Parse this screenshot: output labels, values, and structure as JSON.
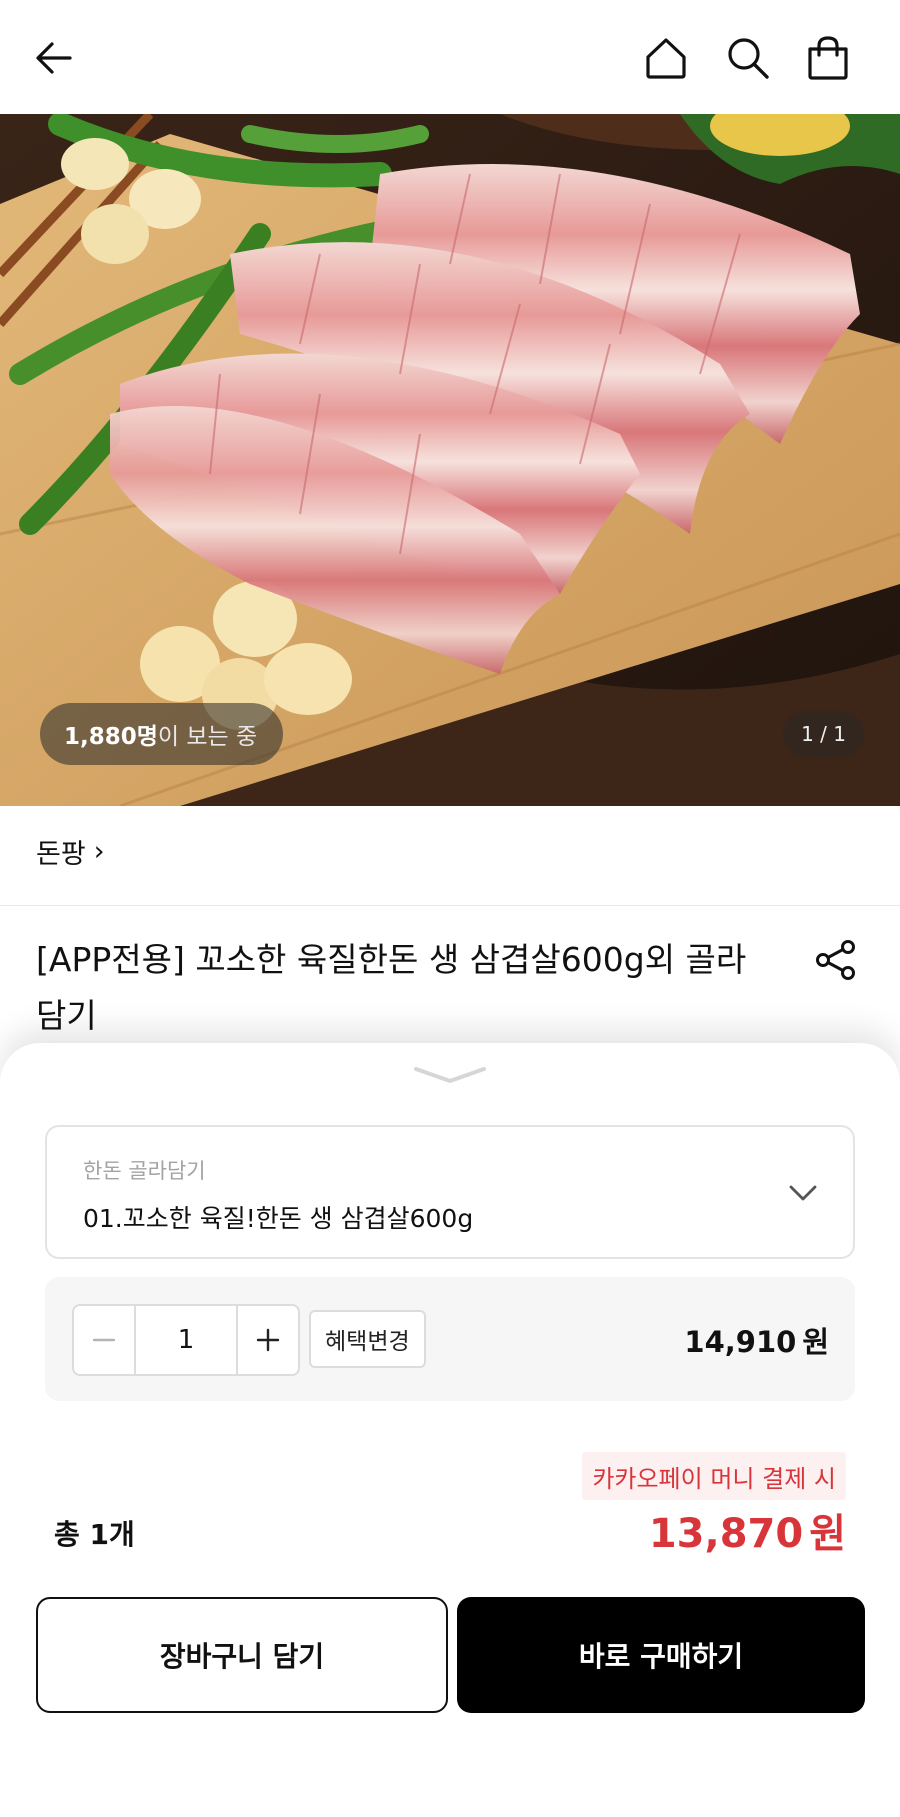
{
  "header": {
    "back_icon": "arrow-left-icon",
    "home_icon": "home-icon",
    "search_icon": "search-icon",
    "bag_icon": "shopping-bag-icon"
  },
  "hero": {
    "viewer_count": "1,880명",
    "viewer_suffix": "이 보는 중",
    "pager": "1 / 1"
  },
  "product": {
    "seller": "돈팡",
    "seller_chevron": "›",
    "title": "[APP전용] 꼬소한 육질한돈 생 삼겹살600g외 골라담기",
    "share_icon": "share-icon"
  },
  "sheet": {
    "option_label": "한돈 골라담기",
    "option_value": "01.꼬소한 육질!한돈 생 삼겹살600g",
    "quantity": "1",
    "benefit_button": "혜택변경",
    "line_price": "14,910",
    "currency": "원",
    "kakao_note": "카카오페이 머니 결제 시",
    "total_count": "총 1개",
    "total_price": "13,870",
    "cart_button": "장바구니 담기",
    "buy_button": "바로 구매하기"
  },
  "colors": {
    "accent_red": "#d8353a",
    "buy_button_bg": "#000000",
    "kakao_badge_bg": "#fdf0f0"
  }
}
